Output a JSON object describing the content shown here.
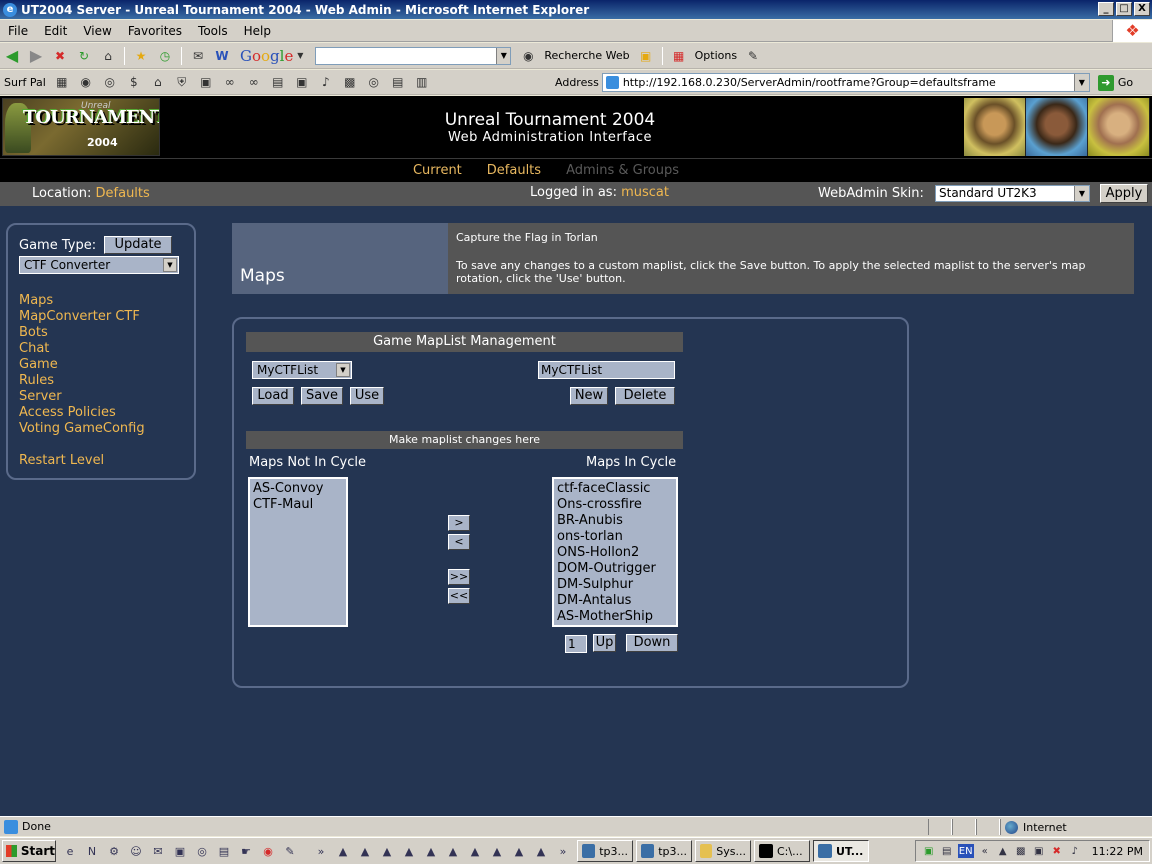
{
  "window": {
    "title": "UT2004 Server - Unreal Tournament 2004 - Web Admin - Microsoft Internet Explorer",
    "controls": [
      "_",
      "□",
      "X"
    ]
  },
  "menu": [
    "File",
    "Edit",
    "View",
    "Favorites",
    "Tools",
    "Help"
  ],
  "toolbar1": {
    "google_letters": [
      "G",
      "o",
      "o",
      "g",
      "l",
      "e"
    ],
    "search_value": "",
    "web_search_label": "Recherche Web",
    "options_label": "Options"
  },
  "toolbar2": {
    "surf_label": "Surf Pal",
    "address_label": "Address",
    "address_url": "http://192.168.0.230/ServerAdmin/rootframe?Group=defaultsframe",
    "go_label": "Go"
  },
  "header": {
    "logo_top": "Unreal",
    "logo_main": "TOURNAMENT",
    "logo_year": "2004",
    "title": "Unreal Tournament 2004",
    "subtitle": "Web Administration Interface"
  },
  "nav": {
    "current": "Current",
    "defaults": "Defaults",
    "admins": "Admins & Groups"
  },
  "location_bar": {
    "location_label": "Location:",
    "location_value": "Defaults",
    "logged_label": "Logged in as:",
    "logged_user": "muscat",
    "skin_label": "WebAdmin Skin:",
    "skin_value": "Standard UT2K3",
    "apply_label": "Apply"
  },
  "sidebar": {
    "game_type_label": "Game Type:",
    "update_label": "Update",
    "game_type_value": "CTF Converter",
    "links": [
      "Maps",
      "MapConverter CTF",
      "Bots",
      "Chat",
      "Game",
      "Rules",
      "Server",
      "Access Policies",
      "Voting GameConfig"
    ],
    "restart_label": "Restart Level"
  },
  "info": {
    "page_title": "Maps",
    "line1": "Capture the Flag in Torlan",
    "line2": "To save any changes to a custom maplist, click the Save button. To apply the selected maplist to the server's map rotation, click the 'Use' button."
  },
  "maplist": {
    "header": "Game MapList Management",
    "selected_list": "MyCTFList",
    "name_value": "MyCTFList",
    "load_label": "Load",
    "save_label": "Save",
    "use_label": "Use",
    "new_label": "New",
    "delete_label": "Delete",
    "changes_header": "Make maplist changes here",
    "not_in_cycle_label": "Maps Not In Cycle",
    "in_cycle_label": "Maps In Cycle",
    "not_in_cycle": [
      "AS-Convoy",
      "CTF-Maul"
    ],
    "in_cycle": [
      "ctf-faceClassic",
      "Ons-crossfire",
      "BR-Anubis",
      "ons-torlan",
      "ONS-Hollon2",
      "DOM-Outrigger",
      "DM-Sulphur",
      "DM-Antalus",
      "AS-MotherShip"
    ],
    "add_label": ">",
    "remove_label": "<",
    "add_all_label": ">>",
    "remove_all_label": "<<",
    "step_value": "1",
    "up_label": "Up",
    "down_label": "Down"
  },
  "status": {
    "text": "Done",
    "zone": "Internet"
  },
  "taskbar": {
    "start_label": "Start",
    "tasks": [
      "tp3...",
      "tp3...",
      "Sys...",
      "C:\\...",
      "UT..."
    ],
    "lang": "EN",
    "clock": "11:22 PM"
  }
}
